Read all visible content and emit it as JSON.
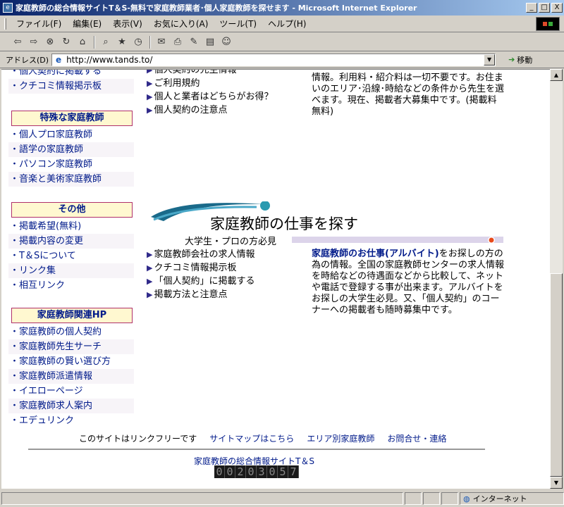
{
  "window": {
    "title": "家庭教師の総合情報サイトT＆S-無料で家庭教師業者･個人家庭教師を探せます - Microsoft Internet Explorer",
    "minimize": "_",
    "maximize": "□",
    "close": "X"
  },
  "menu": {
    "items": [
      "ファイル(F)",
      "編集(E)",
      "表示(V)",
      "お気に入り(A)",
      "ツール(T)",
      "ヘルプ(H)"
    ]
  },
  "toolbar": {
    "icons": [
      "back-icon",
      "forward-icon",
      "stop-icon",
      "refresh-icon",
      "home-icon",
      "search-icon",
      "favorites-icon",
      "history-icon",
      "mail-icon",
      "print-icon",
      "edit-icon",
      "discuss-icon",
      "messenger-icon"
    ]
  },
  "address": {
    "label": "アドレス(D)",
    "url": "http://www.tands.to/",
    "go_label": "移動"
  },
  "sidebar": {
    "top_items": [
      "・個人契約に掲載する",
      "・クチコミ情報掲示板"
    ],
    "sections": [
      {
        "heading": "特殊な家庭教師",
        "items": [
          "・個人プロ家庭教師",
          "・語学の家庭教師",
          "・パソコン家庭教師",
          "・音楽と美術家庭教師"
        ]
      },
      {
        "heading": "その他",
        "items": [
          "・掲載希望(無料)",
          "・掲載内容の変更",
          "・T＆Sについて",
          "・リンク集",
          "・相互リンク"
        ]
      },
      {
        "heading": "家庭教師関連HP",
        "items": [
          "・家庭教師の個人契約",
          "・家庭教師先生サーチ",
          "・家庭教師の賢い選び方",
          "・家庭教師派遣情報",
          "・イエローページ",
          "・家庭教師求人案内",
          "・エデュリンク"
        ]
      }
    ]
  },
  "middle_top": {
    "items": [
      "個人契約の先生情報",
      "ご利用規約",
      "個人と業者はどちらがお得？",
      "個人契約の注意点"
    ]
  },
  "right_top": {
    "text": "情報。利用料・紹介料は一切不要です。お住まいのエリア･沿線･時給などの条件から先生を選べます。現在、掲載者大募集中です。(掲載料無料)"
  },
  "banner": {
    "title": "家庭教師の仕事を探す",
    "subtitle": "大学生・プロの方必見"
  },
  "middle_bottom": {
    "items": [
      "家庭教師会社の求人情報",
      "クチコミ情報掲示板",
      "「個人契約」に掲載する",
      "掲載方法と注意点"
    ]
  },
  "right_bottom": {
    "link": "家庭教師のお仕事(アルバイト)",
    "text": "をお探しの方の為の情報。全国の家庭教師センターの求人情報を時給などの待遇面などから比較して、ネットや電話で登録する事が出来ます。アルバイトをお探しの大学生必見。又、「個人契約」のコーナーへの掲載者も随時募集中です。"
  },
  "footer": {
    "note": "このサイトはリンクフリーです",
    "links": [
      "サイトマップはこちら",
      "エリア別家庭教師",
      "お問合せ・連絡"
    ],
    "site_name": "家庭教師の総合情報サイトT＆S",
    "counter": "00203057"
  },
  "status": {
    "zone": "インターネット"
  },
  "colors": {
    "link": "#001a8a",
    "heading_bg": "#fff8d0",
    "heading_border": "#b0306a",
    "titlebar": "#0a246a"
  }
}
